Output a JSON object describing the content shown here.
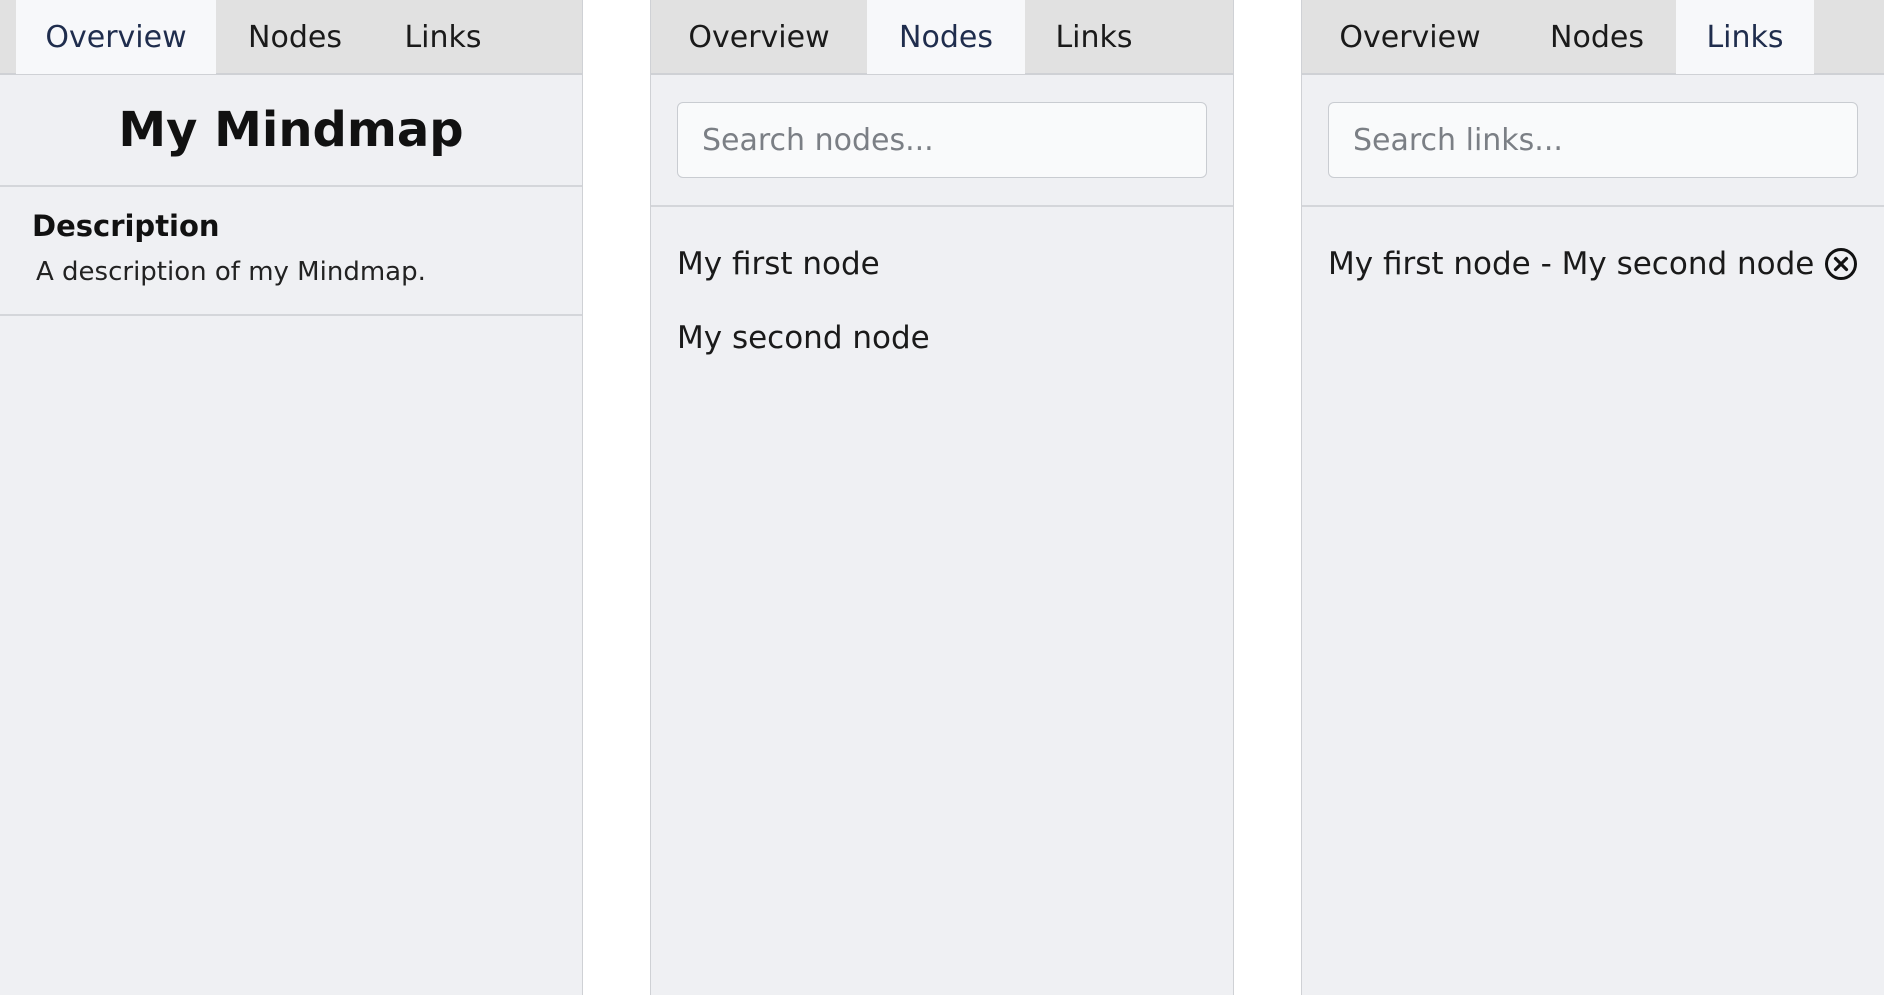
{
  "tabs": {
    "overview": "Overview",
    "nodes": "Nodes",
    "links": "Links"
  },
  "overview": {
    "title": "My Mindmap",
    "description_heading": "Description",
    "description": "A description of my Mindmap."
  },
  "nodes": {
    "search_placeholder": "Search nodes...",
    "items": [
      "My first node",
      "My second node"
    ]
  },
  "links": {
    "search_placeholder": "Search links...",
    "items": [
      {
        "label": "My first node - My second node",
        "action_icon": "close-circle-icon"
      }
    ]
  }
}
